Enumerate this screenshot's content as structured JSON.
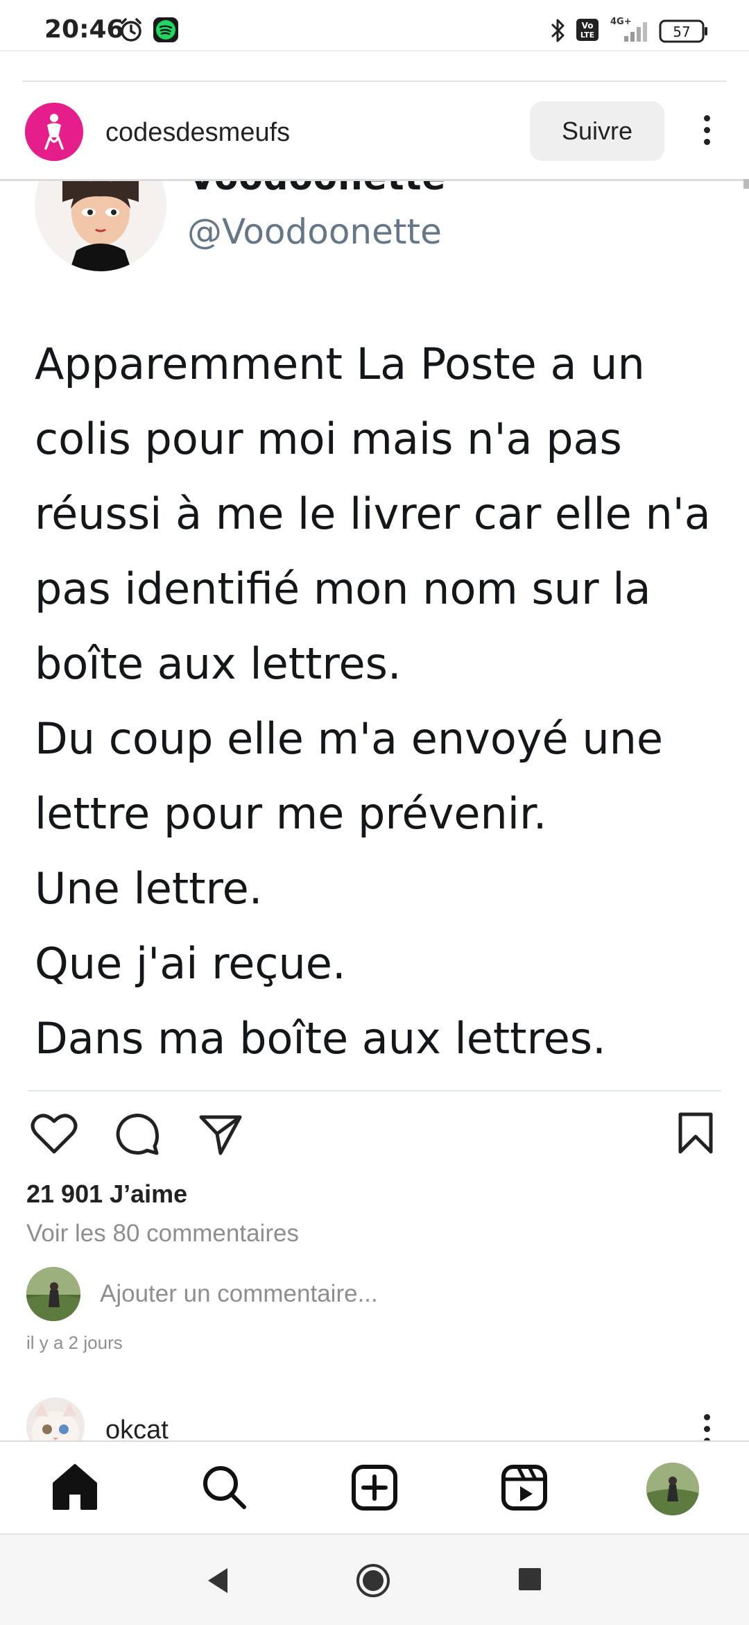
{
  "status_bar": {
    "time": "20:46",
    "battery": "57",
    "network": "4G+",
    "icons": [
      "alarm-icon",
      "spotify-icon",
      "bluetooth-icon",
      "volte-icon",
      "signal-icon",
      "battery-icon"
    ]
  },
  "post": {
    "username": "codesdesmeufs",
    "follow_label": "Suivre",
    "tweet": {
      "name": "Voodoonette",
      "handle": "@Voodoonette",
      "lines": [
        "Apparemment La Poste a un",
        "colis pour moi mais n'a pas",
        "réussi à me le livrer car elle n'a",
        "pas identifié mon nom sur la",
        "boîte aux lettres.",
        "Du coup elle m'a envoyé une",
        "lettre pour me prévenir.",
        "Une lettre.",
        "Que j'ai reçue.",
        "Dans ma boîte aux lettres."
      ]
    },
    "likes": "21 901 J’aime",
    "view_comments": "Voir les 80 commentaires",
    "comment_placeholder": "Ajouter un commentaire...",
    "time_ago": "il y a 2 jours"
  },
  "next_post": {
    "username": "okcat"
  },
  "bottom_nav": {
    "items": [
      "home-icon",
      "search-icon",
      "new-post-icon",
      "reels-icon",
      "profile-avatar"
    ]
  },
  "system_nav": {
    "items": [
      "back-button",
      "home-button",
      "recents-button"
    ]
  },
  "colors": {
    "brand_pink": "#e61e8c",
    "text_primary": "#262626",
    "text_secondary": "#8e8e8e",
    "twitter_handle": "#657786",
    "follow_button_bg": "#efefef"
  }
}
